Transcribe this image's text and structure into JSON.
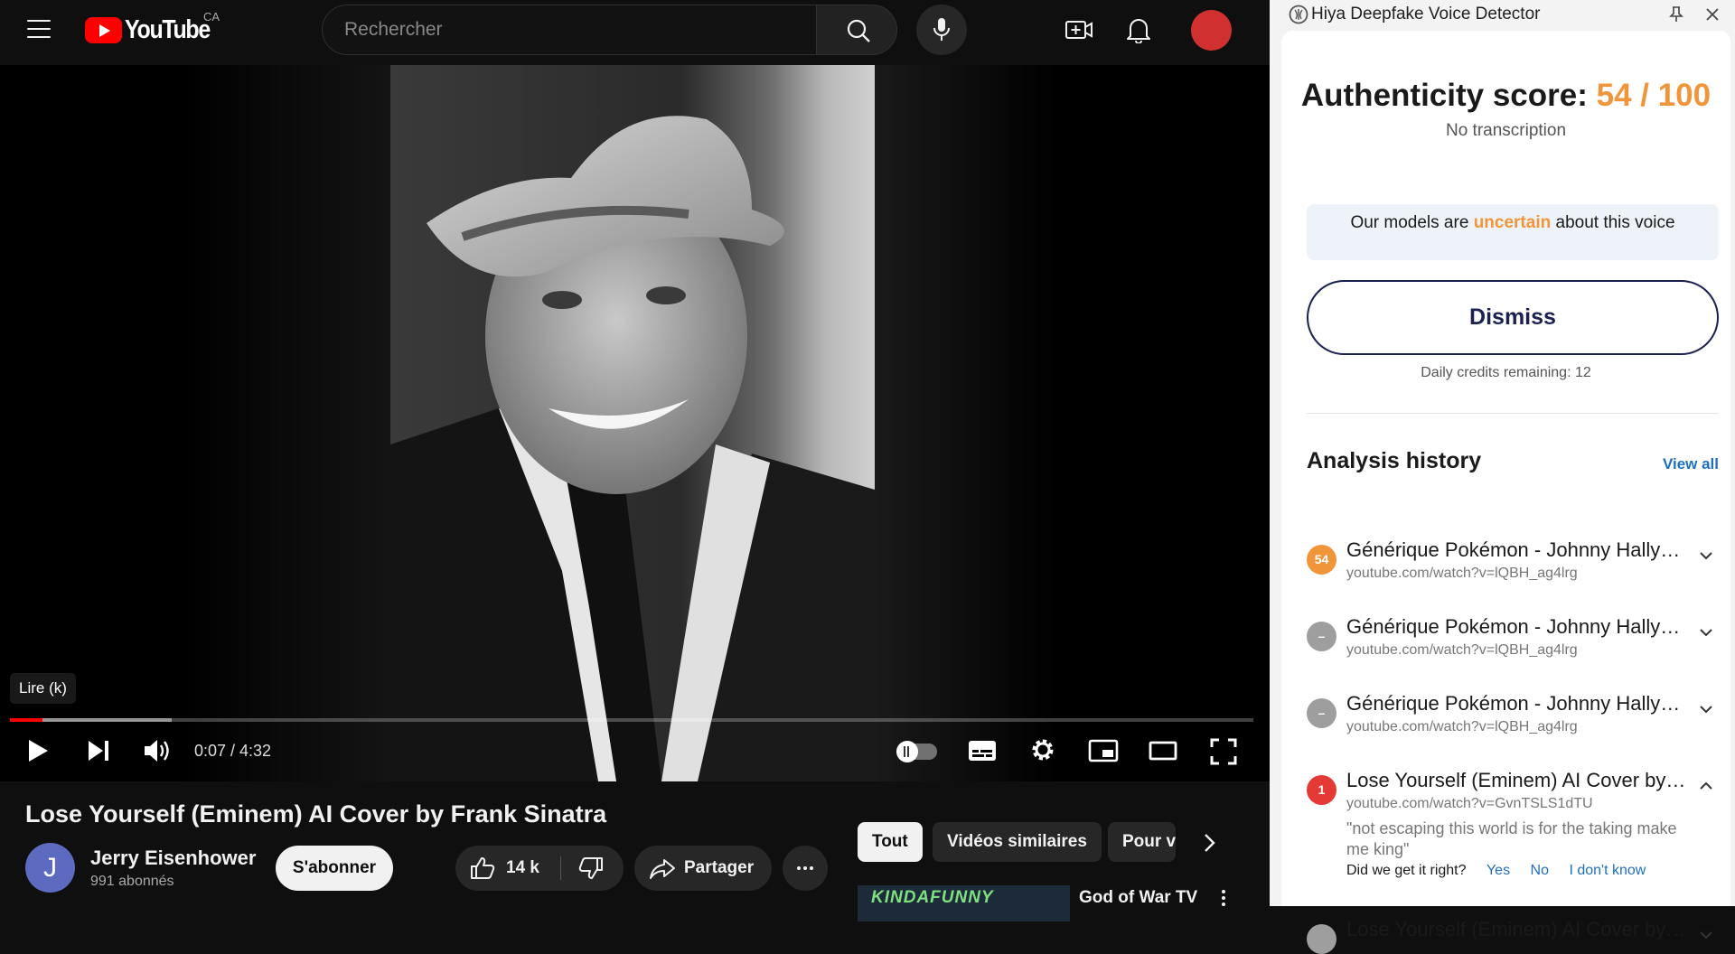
{
  "topbar": {
    "logo_text": "YouTube",
    "country_code": "CA",
    "search_placeholder": "Rechercher"
  },
  "player": {
    "tooltip": "Lire (k)",
    "time_display": "0:07 / 4:32",
    "played_fraction": 0.026,
    "buffered_fraction": 0.13
  },
  "video": {
    "title": "Lose Yourself (Eminem) AI Cover by Frank Sinatra",
    "channel_initial": "J",
    "channel_name": "Jerry Eisenhower",
    "subscribers": "991 abonnés",
    "subscribe_label": "S'abonner",
    "likes": "14 k",
    "share_label": "Partager"
  },
  "chips": [
    {
      "label": "Tout",
      "active": true
    },
    {
      "label": "Vidéos similaires",
      "active": false
    },
    {
      "label": "Pour v",
      "active": false
    }
  ],
  "recommendation": {
    "thumb_text": "KINDAFUNNY",
    "title": "God of War TV"
  },
  "extension": {
    "title": "Hiya Deepfake Voice Detector",
    "auth_label": "Authenticity score:",
    "auth_score": "54 / 100",
    "no_transcription": "No transcription",
    "uncertain_pre": "Our models are",
    "uncertain_word": "uncertain",
    "uncertain_post": "about this voice",
    "dismiss_label": "Dismiss",
    "credits": "Daily credits remaining: 12",
    "history_title": "Analysis history",
    "view_all": "View all",
    "colors": {
      "orange": "#f0953a",
      "red": "#e53935",
      "grey": "#9e9e9e",
      "navy": "#1a2050",
      "link": "#1f6fbf"
    },
    "history": [
      {
        "badge": "54",
        "badge_color": "#f0953a",
        "title": "Générique Pokémon - Johnny Hallyday",
        "url": "youtube.com/watch?v=lQBH_ag4lrg",
        "expanded": false
      },
      {
        "badge": "–",
        "badge_color": "#9e9e9e",
        "title": "Générique Pokémon - Johnny Hallyday",
        "url": "youtube.com/watch?v=lQBH_ag4lrg",
        "expanded": false
      },
      {
        "badge": "–",
        "badge_color": "#9e9e9e",
        "title": "Générique Pokémon - Johnny Hallyday",
        "url": "youtube.com/watch?v=lQBH_ag4lrg",
        "expanded": false
      },
      {
        "badge": "1",
        "badge_color": "#e53935",
        "title": "Lose Yourself (Eminem) AI Cover by Frank Sinatra",
        "url": "youtube.com/watch?v=GvnTSLS1dTU",
        "expanded": true,
        "quote": "\"not escaping this world is for the taking make me king\"",
        "question": "Did we get it right?",
        "answers": [
          "Yes",
          "No",
          "I don't know"
        ]
      },
      {
        "badge": "",
        "badge_color": "#9e9e9e",
        "title": "Lose Yourself (Eminem) AI Cover by Frank Sinatra",
        "url": "",
        "expanded": false
      }
    ]
  }
}
